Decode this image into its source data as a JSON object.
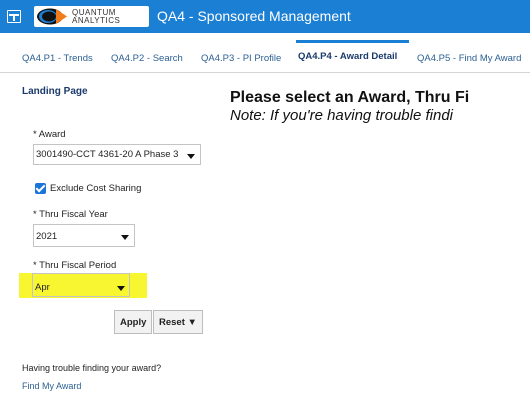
{
  "header": {
    "logo_text": "QUANTUM ANALYTICS",
    "app_title": "QA4 - Sponsored Management"
  },
  "tabs": [
    {
      "label": "QA4.P1 - Trends"
    },
    {
      "label": "QA4.P2 - Search"
    },
    {
      "label": "QA4.P3 - PI Profile"
    },
    {
      "label": "QA4.P4 - Award Detail",
      "active": true
    },
    {
      "label": "QA4.P5 - Find My Award"
    }
  ],
  "sidebar": {
    "landing_label": "Landing Page",
    "award_label": "* Award",
    "award_value": "3001490-CCT 4361-20 A Phase 3",
    "exclude_cost_sharing_label": "Exclude Cost Sharing",
    "exclude_cost_sharing_checked": true,
    "fiscal_year_label": "* Thru Fiscal Year",
    "fiscal_year_value": "2021",
    "fiscal_period_label": "* Thru Fiscal Period",
    "fiscal_period_value": "Apr",
    "apply_label": "Apply",
    "reset_label": "Reset ▼",
    "help_text": "Having trouble finding your award?",
    "help_link": "Find My Award"
  },
  "main": {
    "heading": "Please select an Award, Thru Fi",
    "note": "Note: If you're having trouble findi"
  },
  "colors": {
    "topbar": "#1b7fd4",
    "highlight": "#f8f531",
    "link": "#2c5f94"
  }
}
